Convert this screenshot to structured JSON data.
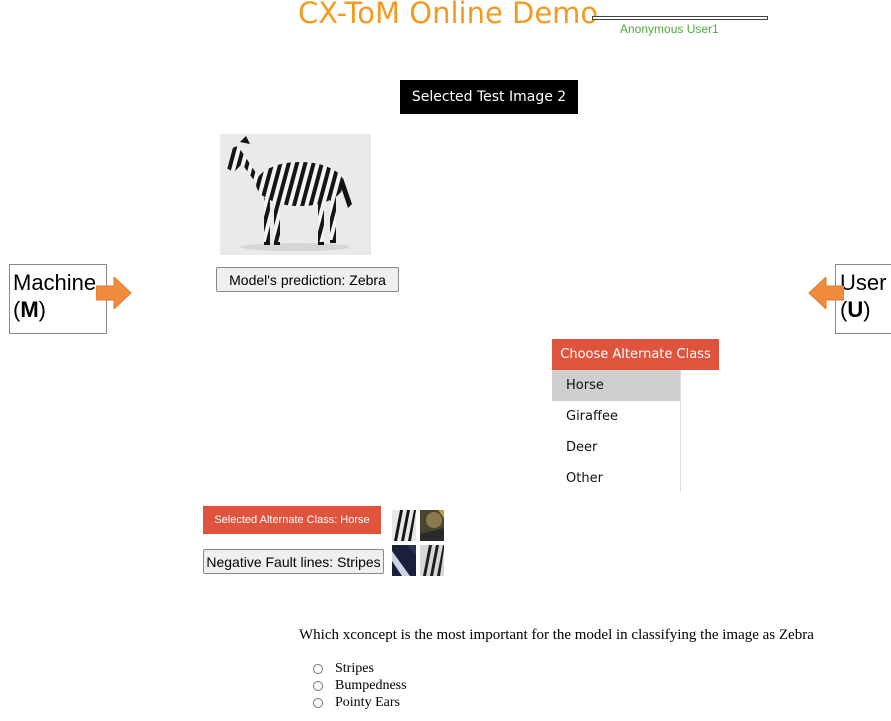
{
  "header": {
    "title": "CX-ToM Online Demo",
    "user": "Anonymous User1"
  },
  "selected_image_label": "Selected Test Image 2",
  "prediction_label": "Model's prediction: Zebra",
  "machine": {
    "label": "Machine",
    "abbr": "M"
  },
  "user_box": {
    "label": "User",
    "abbr": "U"
  },
  "dropdown": {
    "title": "Choose Alternate Class",
    "items": [
      "Horse",
      "Giraffee",
      "Deer",
      "Other"
    ],
    "active_index": 0
  },
  "alternate": {
    "selected_label": "Selected Alternate Class: Horse",
    "negative_label": "Negative Fault lines: Stripes"
  },
  "question": {
    "text": "Which xconcept is the most important for the model in classifying the image as Zebra",
    "options": [
      "Stripes",
      "Bumpedness",
      "Pointy Ears"
    ]
  },
  "colors": {
    "title_orange": "#f39a21",
    "accent_red": "#e0533d",
    "arrow_orange": "#f08a3c",
    "user_green": "#4caa3a"
  }
}
